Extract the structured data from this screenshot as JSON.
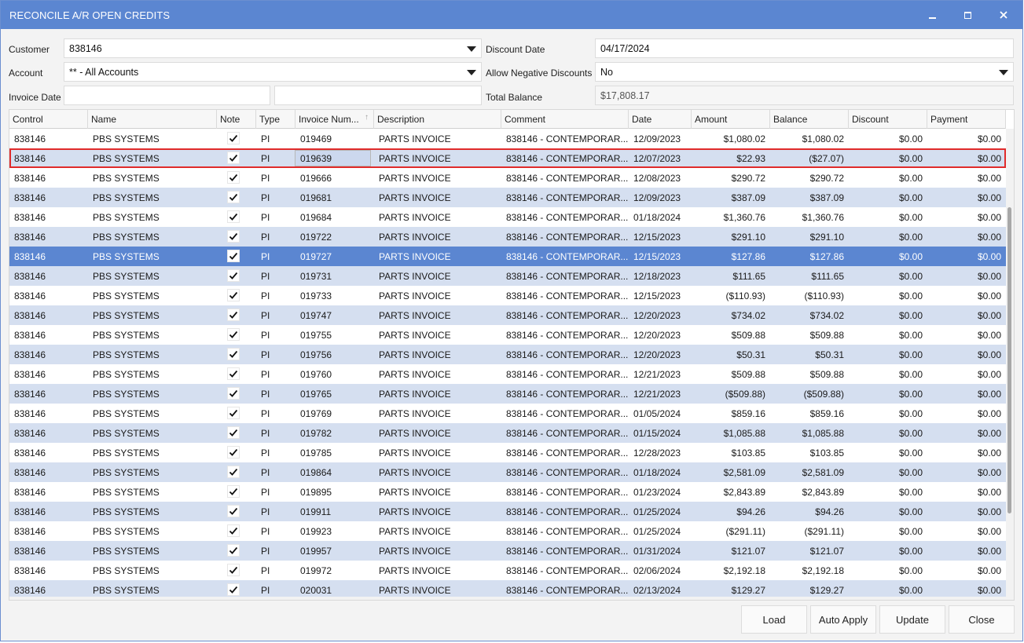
{
  "window": {
    "title": "RECONCILE A/R OPEN CREDITS"
  },
  "form": {
    "customer_label": "Customer",
    "customer_value": "838146",
    "account_label": "Account",
    "account_value": "** - All Accounts",
    "invoice_date_label": "Invoice Date",
    "invoice_date_from": "",
    "invoice_date_to": "",
    "discount_date_label": "Discount Date",
    "discount_date_value": "04/17/2024",
    "allow_neg_label": "Allow Negative Discounts",
    "allow_neg_value": "No",
    "total_balance_label": "Total Balance",
    "total_balance_value": "$17,808.17"
  },
  "grid": {
    "columns": [
      "Control",
      "Name",
      "Note",
      "Type",
      "Invoice Num...",
      "Description",
      "Comment",
      "Date",
      "Amount",
      "Balance",
      "Discount",
      "Payment"
    ],
    "rows": [
      [
        "838146",
        "PBS SYSTEMS",
        "PI",
        "019469",
        "PARTS INVOICE",
        "838146 - CONTEMPORAR...",
        "12/09/2023",
        "$1,080.02",
        "$1,080.02",
        "$0.00",
        "$0.00"
      ],
      [
        "838146",
        "PBS SYSTEMS",
        "PI",
        "019639",
        "PARTS INVOICE",
        "838146 - CONTEMPORAR...",
        "12/07/2023",
        "$22.93",
        "($27.07)",
        "$0.00",
        "$0.00"
      ],
      [
        "838146",
        "PBS SYSTEMS",
        "PI",
        "019666",
        "PARTS INVOICE",
        "838146 - CONTEMPORAR...",
        "12/08/2023",
        "$290.72",
        "$290.72",
        "$0.00",
        "$0.00"
      ],
      [
        "838146",
        "PBS SYSTEMS",
        "PI",
        "019681",
        "PARTS INVOICE",
        "838146 - CONTEMPORAR...",
        "12/09/2023",
        "$387.09",
        "$387.09",
        "$0.00",
        "$0.00"
      ],
      [
        "838146",
        "PBS SYSTEMS",
        "PI",
        "019684",
        "PARTS INVOICE",
        "838146 - CONTEMPORAR...",
        "01/18/2024",
        "$1,360.76",
        "$1,360.76",
        "$0.00",
        "$0.00"
      ],
      [
        "838146",
        "PBS SYSTEMS",
        "PI",
        "019722",
        "PARTS INVOICE",
        "838146 - CONTEMPORAR...",
        "12/15/2023",
        "$291.10",
        "$291.10",
        "$0.00",
        "$0.00"
      ],
      [
        "838146",
        "PBS SYSTEMS",
        "PI",
        "019727",
        "PARTS INVOICE",
        "838146 - CONTEMPORAR...",
        "12/15/2023",
        "$127.86",
        "$127.86",
        "$0.00",
        "$0.00"
      ],
      [
        "838146",
        "PBS SYSTEMS",
        "PI",
        "019731",
        "PARTS INVOICE",
        "838146 - CONTEMPORAR...",
        "12/18/2023",
        "$111.65",
        "$111.65",
        "$0.00",
        "$0.00"
      ],
      [
        "838146",
        "PBS SYSTEMS",
        "PI",
        "019733",
        "PARTS INVOICE",
        "838146 - CONTEMPORAR...",
        "12/15/2023",
        "($110.93)",
        "($110.93)",
        "$0.00",
        "$0.00"
      ],
      [
        "838146",
        "PBS SYSTEMS",
        "PI",
        "019747",
        "PARTS INVOICE",
        "838146 - CONTEMPORAR...",
        "12/20/2023",
        "$734.02",
        "$734.02",
        "$0.00",
        "$0.00"
      ],
      [
        "838146",
        "PBS SYSTEMS",
        "PI",
        "019755",
        "PARTS INVOICE",
        "838146 - CONTEMPORAR...",
        "12/20/2023",
        "$509.88",
        "$509.88",
        "$0.00",
        "$0.00"
      ],
      [
        "838146",
        "PBS SYSTEMS",
        "PI",
        "019756",
        "PARTS INVOICE",
        "838146 - CONTEMPORAR...",
        "12/20/2023",
        "$50.31",
        "$50.31",
        "$0.00",
        "$0.00"
      ],
      [
        "838146",
        "PBS SYSTEMS",
        "PI",
        "019760",
        "PARTS INVOICE",
        "838146 - CONTEMPORAR...",
        "12/21/2023",
        "$509.88",
        "$509.88",
        "$0.00",
        "$0.00"
      ],
      [
        "838146",
        "PBS SYSTEMS",
        "PI",
        "019765",
        "PARTS INVOICE",
        "838146 - CONTEMPORAR...",
        "12/21/2023",
        "($509.88)",
        "($509.88)",
        "$0.00",
        "$0.00"
      ],
      [
        "838146",
        "PBS SYSTEMS",
        "PI",
        "019769",
        "PARTS INVOICE",
        "838146 - CONTEMPORAR...",
        "01/05/2024",
        "$859.16",
        "$859.16",
        "$0.00",
        "$0.00"
      ],
      [
        "838146",
        "PBS SYSTEMS",
        "PI",
        "019782",
        "PARTS INVOICE",
        "838146 - CONTEMPORAR...",
        "01/15/2024",
        "$1,085.88",
        "$1,085.88",
        "$0.00",
        "$0.00"
      ],
      [
        "838146",
        "PBS SYSTEMS",
        "PI",
        "019785",
        "PARTS INVOICE",
        "838146 - CONTEMPORAR...",
        "12/28/2023",
        "$103.85",
        "$103.85",
        "$0.00",
        "$0.00"
      ],
      [
        "838146",
        "PBS SYSTEMS",
        "PI",
        "019864",
        "PARTS INVOICE",
        "838146 - CONTEMPORAR...",
        "01/18/2024",
        "$2,581.09",
        "$2,581.09",
        "$0.00",
        "$0.00"
      ],
      [
        "838146",
        "PBS SYSTEMS",
        "PI",
        "019895",
        "PARTS INVOICE",
        "838146 - CONTEMPORAR...",
        "01/23/2024",
        "$2,843.89",
        "$2,843.89",
        "$0.00",
        "$0.00"
      ],
      [
        "838146",
        "PBS SYSTEMS",
        "PI",
        "019911",
        "PARTS INVOICE",
        "838146 - CONTEMPORAR...",
        "01/25/2024",
        "$94.26",
        "$94.26",
        "$0.00",
        "$0.00"
      ],
      [
        "838146",
        "PBS SYSTEMS",
        "PI",
        "019923",
        "PARTS INVOICE",
        "838146 - CONTEMPORAR...",
        "01/25/2024",
        "($291.11)",
        "($291.11)",
        "$0.00",
        "$0.00"
      ],
      [
        "838146",
        "PBS SYSTEMS",
        "PI",
        "019957",
        "PARTS INVOICE",
        "838146 - CONTEMPORAR...",
        "01/31/2024",
        "$121.07",
        "$121.07",
        "$0.00",
        "$0.00"
      ],
      [
        "838146",
        "PBS SYSTEMS",
        "PI",
        "019972",
        "PARTS INVOICE",
        "838146 - CONTEMPORAR...",
        "02/06/2024",
        "$2,192.18",
        "$2,192.18",
        "$0.00",
        "$0.00"
      ],
      [
        "838146",
        "PBS SYSTEMS",
        "PI",
        "020031",
        "PARTS INVOICE",
        "838146 - CONTEMPORAR...",
        "02/13/2024",
        "$129.27",
        "$129.27",
        "$0.00",
        "$0.00"
      ]
    ],
    "note_checked": [
      true,
      true,
      true,
      true,
      true,
      true,
      true,
      true,
      true,
      true,
      true,
      true,
      true,
      true,
      true,
      true,
      true,
      true,
      true,
      true,
      true,
      true,
      true,
      true
    ],
    "selected_row": 6,
    "highlighted_row": 1,
    "sort_icon": "sort-ascending-icon"
  },
  "buttons": {
    "load": "Load",
    "auto_apply": "Auto Apply",
    "update": "Update",
    "close": "Close"
  },
  "colors": {
    "titlebar": "#5b86d1",
    "row_alt": "#d5dff0",
    "selected": "#5b86d1",
    "highlight_border": "#e02b2b"
  }
}
